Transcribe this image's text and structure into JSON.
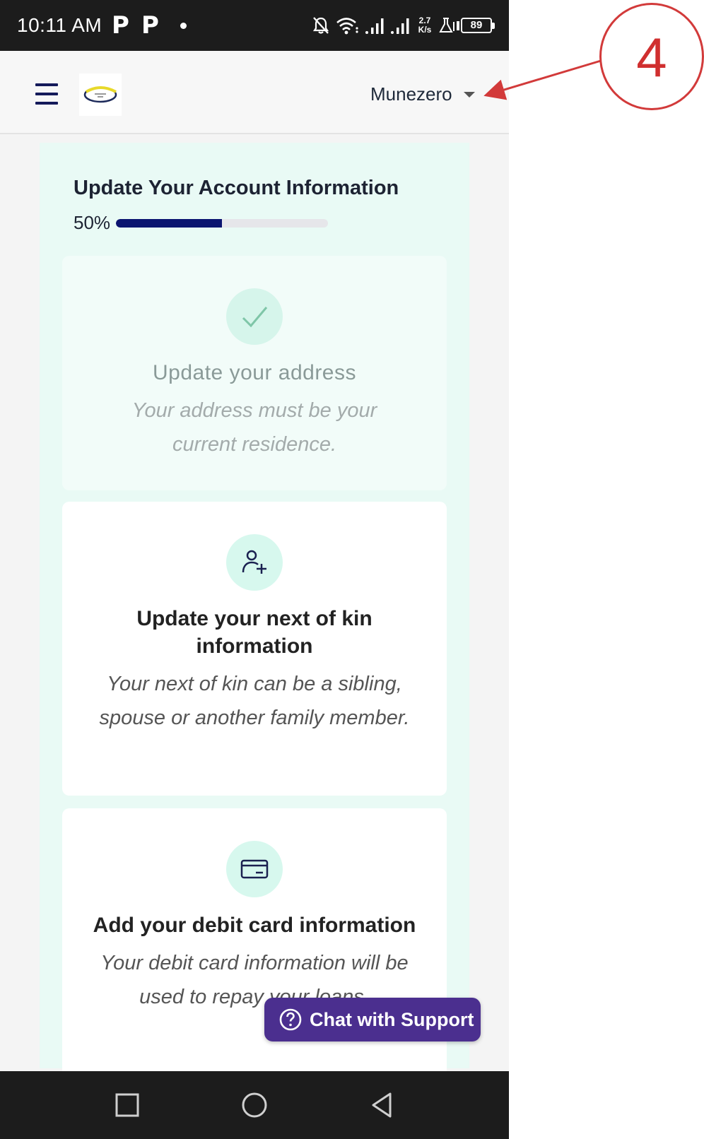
{
  "status_bar": {
    "time": "10:11 AM",
    "p_icons": [
      "P",
      "P"
    ],
    "net_speed_top": "2.7",
    "net_speed_bottom": "K/s",
    "battery": "89"
  },
  "header": {
    "user_name": "Munezero",
    "icons": {
      "menu": "hamburger-menu-icon",
      "caret": "caret-down-icon",
      "logo": "app-logo"
    }
  },
  "onboarding": {
    "title": "Update Your Account Information",
    "progress_label": "50%",
    "progress_value": 0.5,
    "cards": [
      {
        "title": "Update your address",
        "description": "Your address must be your current residence.",
        "icon": "check-icon",
        "completed": true
      },
      {
        "title": "Update your next of kin information",
        "description": "Your next of kin can be a sibling, spouse or another family member.",
        "icon": "user-plus-icon",
        "completed": false
      },
      {
        "title": "Add your debit card information",
        "description": "Your debit card information will be used to repay your loans.",
        "icon": "credit-card-icon",
        "completed": false
      }
    ]
  },
  "chat": {
    "label": "Chat with Support",
    "icon": "help-circle-icon"
  },
  "annotation": {
    "number": "4",
    "color": "#d23a3a"
  },
  "colors": {
    "accent": "#0b1470",
    "panel_bg": "#e9faf5",
    "chat_bg": "#4b2f8f"
  }
}
